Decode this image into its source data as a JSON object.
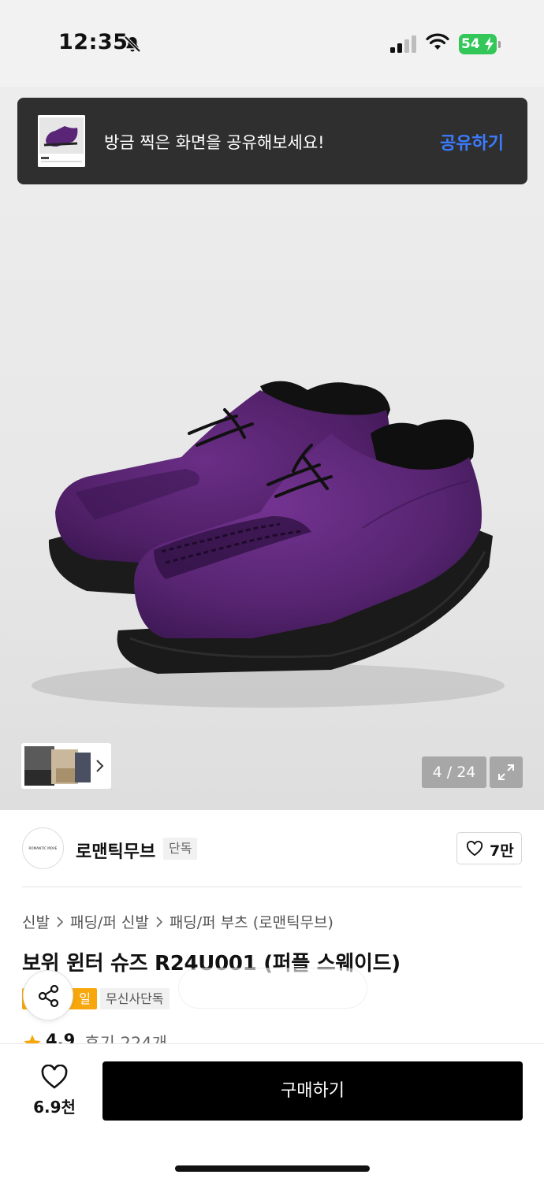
{
  "status_bar": {
    "time": "12:35",
    "battery": "54"
  },
  "toast": {
    "message": "방금 찍은 화면을 공유해보세요!",
    "action": "공유하기"
  },
  "gallery": {
    "counter": "4 / 24"
  },
  "brand": {
    "logo_text": "ROMANTIC MOVE",
    "name": "로맨틱무브",
    "badge": "단독",
    "likes": "7만"
  },
  "breadcrumb": [
    "신발",
    "패딩/퍼 신발",
    "패딩/퍼 부츠 (로맨틱무브)"
  ],
  "product": {
    "title": "보위 윈터 슈즈 R24U001 (퍼플 스웨이드)",
    "tag_sale": "일",
    "tag_exclusive": "무신사단독",
    "rating": "4.9",
    "reviews": "후기 224개"
  },
  "bottom_bar": {
    "wishlist_count": "6.9천",
    "buy_label": "구매하기"
  },
  "colors": {
    "buy_button": "#000000",
    "share_link": "#3b7bff",
    "sale_tag": "#f7a70c",
    "battery": "#33c75a",
    "star": "#f7a70c"
  },
  "icons": [
    "bell-slash-icon",
    "signal-icon",
    "wifi-icon",
    "battery-icon",
    "chevron-right-icon",
    "expand-icon",
    "heart-icon",
    "share-icon",
    "star-icon"
  ]
}
